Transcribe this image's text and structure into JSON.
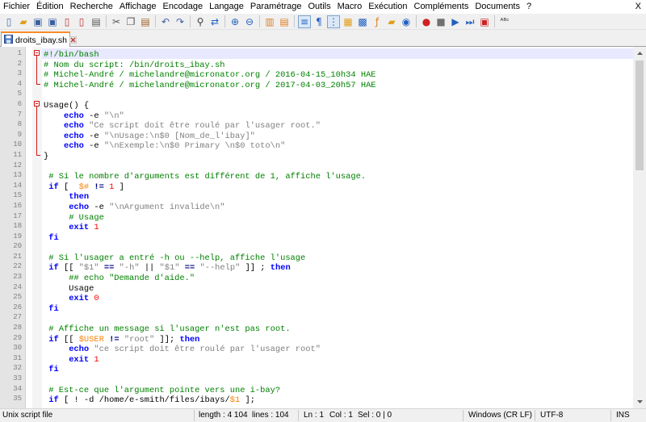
{
  "window": {
    "close_glyph": "X"
  },
  "menu": [
    "Fichier",
    "Édition",
    "Recherche",
    "Affichage",
    "Encodage",
    "Langage",
    "Paramétrage",
    "Outils",
    "Macro",
    "Exécution",
    "Compléments",
    "Documents",
    "?"
  ],
  "toolbar": {
    "groups": [
      [
        {
          "name": "new-file-icon",
          "glyph": "▯",
          "color": "#4a6fb5"
        },
        {
          "name": "open-file-icon",
          "glyph": "▰",
          "color": "#e0a020"
        },
        {
          "name": "save-icon",
          "glyph": "▣",
          "color": "#3a5fa0"
        },
        {
          "name": "save-all-icon",
          "glyph": "▣",
          "color": "#3a5fa0"
        },
        {
          "name": "close-file-icon",
          "glyph": "▯",
          "color": "#c03030"
        },
        {
          "name": "close-all-icon",
          "glyph": "▯",
          "color": "#c03030"
        },
        {
          "name": "print-icon",
          "glyph": "▤",
          "color": "#555555"
        }
      ],
      [
        {
          "name": "cut-icon",
          "glyph": "✂",
          "color": "#555555"
        },
        {
          "name": "copy-icon",
          "glyph": "❐",
          "color": "#555555"
        },
        {
          "name": "paste-icon",
          "glyph": "▤",
          "color": "#a06020"
        }
      ],
      [
        {
          "name": "undo-icon",
          "glyph": "↶",
          "color": "#4060a0"
        },
        {
          "name": "redo-icon",
          "glyph": "↷",
          "color": "#4060a0"
        }
      ],
      [
        {
          "name": "find-icon",
          "glyph": "⚲",
          "color": "#404040"
        },
        {
          "name": "replace-icon",
          "glyph": "⇄",
          "color": "#2060c0"
        }
      ],
      [
        {
          "name": "zoom-in-icon",
          "glyph": "⊕",
          "color": "#2060c0"
        },
        {
          "name": "zoom-out-icon",
          "glyph": "⊖",
          "color": "#2060c0"
        }
      ],
      [
        {
          "name": "sync-vertical-icon",
          "glyph": "▥",
          "color": "#e08020"
        },
        {
          "name": "sync-horizontal-icon",
          "glyph": "▤",
          "color": "#e08020"
        }
      ],
      [
        {
          "name": "word-wrap-icon",
          "glyph": "≡",
          "color": "#2060c0",
          "active": true
        },
        {
          "name": "show-all-chars-icon",
          "glyph": "¶",
          "color": "#2060c0"
        },
        {
          "name": "indent-guide-icon",
          "glyph": "⋮",
          "color": "#2060c0",
          "active": true
        },
        {
          "name": "user-language-icon",
          "glyph": "▦",
          "color": "#e0a020"
        },
        {
          "name": "document-map-icon",
          "glyph": "▩",
          "color": "#2060c0"
        },
        {
          "name": "function-list-icon",
          "glyph": "ƒ",
          "color": "#e08020"
        },
        {
          "name": "folder-workspace-icon",
          "glyph": "▰",
          "color": "#e0a020"
        },
        {
          "name": "monitoring-icon",
          "glyph": "◉",
          "color": "#2060c0"
        }
      ],
      [
        {
          "name": "record-macro-icon",
          "glyph": "●",
          "color": "#d02020"
        },
        {
          "name": "stop-record-icon",
          "glyph": "■",
          "color": "#707070"
        },
        {
          "name": "play-macro-icon",
          "glyph": "▶",
          "color": "#2060c0"
        },
        {
          "name": "play-multiple-icon",
          "glyph": "⏭",
          "color": "#2060c0"
        },
        {
          "name": "save-macro-icon",
          "glyph": "▣",
          "color": "#d02020"
        }
      ],
      [
        {
          "name": "spell-check-icon",
          "glyph": "ᴬᴮᶜ",
          "color": "#303030"
        }
      ]
    ]
  },
  "tab": {
    "label": "droits_ibay.sh"
  },
  "editor": {
    "current_line": 1,
    "lines": [
      [
        [
          "cm",
          "#!/bin/bash"
        ]
      ],
      [
        [
          "cm",
          "# Nom du script: /bin/droits_ibay.sh"
        ]
      ],
      [
        [
          "cm",
          "# Michel-André / michelandre@micronator.org / 2016-04-15_10h34 HAE"
        ]
      ],
      [
        [
          "cm",
          "# Michel-André / michelandre@micronator.org / 2017-04-03_20h57 HAE"
        ]
      ],
      [],
      [
        [
          "",
          "Usage() {"
        ]
      ],
      [
        [
          "",
          "    "
        ],
        [
          "kw",
          "echo"
        ],
        [
          "",
          " -e "
        ],
        [
          "str",
          "\"\\n\""
        ]
      ],
      [
        [
          "",
          "    "
        ],
        [
          "kw",
          "echo"
        ],
        [
          "",
          " "
        ],
        [
          "str",
          "\"Ce script doit être roulé par l'usager root.\""
        ]
      ],
      [
        [
          "",
          "    "
        ],
        [
          "kw",
          "echo"
        ],
        [
          "",
          " -e "
        ],
        [
          "str",
          "\"\\nUsage:\\n$0 [Nom_de_l'ibay]\""
        ]
      ],
      [
        [
          "",
          "    "
        ],
        [
          "kw",
          "echo"
        ],
        [
          "",
          " -e "
        ],
        [
          "str",
          "\"\\nExemple:\\n$0 Primary \\n$0 toto\\n\""
        ]
      ],
      [
        [
          "",
          "}"
        ]
      ],
      [],
      [
        [
          "",
          " "
        ],
        [
          "cm",
          "# Si le nombre d'arguments est différent de 1, affiche l'usage."
        ]
      ],
      [
        [
          "",
          " "
        ],
        [
          "kw",
          "if"
        ],
        [
          "",
          " [  "
        ],
        [
          "var",
          "$#"
        ],
        [
          "",
          " "
        ],
        [
          "op",
          "!="
        ],
        [
          "",
          " "
        ],
        [
          "num",
          "1"
        ],
        [
          "",
          " ]"
        ]
      ],
      [
        [
          "",
          "     "
        ],
        [
          "kw",
          "then"
        ]
      ],
      [
        [
          "",
          "     "
        ],
        [
          "kw",
          "echo"
        ],
        [
          "",
          " -e "
        ],
        [
          "str",
          "\"\\nArgument invalide\\n\""
        ]
      ],
      [
        [
          "",
          "     "
        ],
        [
          "cm",
          "# Usage"
        ]
      ],
      [
        [
          "",
          "     "
        ],
        [
          "kw",
          "exit"
        ],
        [
          "",
          " "
        ],
        [
          "num",
          "1"
        ]
      ],
      [
        [
          "",
          " "
        ],
        [
          "kw",
          "fi"
        ]
      ],
      [],
      [
        [
          "",
          " "
        ],
        [
          "cm",
          "# Si l'usager a entré -h ou --help, affiche l'usage"
        ]
      ],
      [
        [
          "",
          " "
        ],
        [
          "kw",
          "if"
        ],
        [
          "",
          " [[ "
        ],
        [
          "str",
          "\"$1\""
        ],
        [
          "",
          " "
        ],
        [
          "op",
          "=="
        ],
        [
          "",
          " "
        ],
        [
          "str",
          "\"-h\""
        ],
        [
          "",
          " || "
        ],
        [
          "str",
          "\"$1\""
        ],
        [
          "",
          " "
        ],
        [
          "op",
          "=="
        ],
        [
          "",
          " "
        ],
        [
          "str",
          "\"--help\""
        ],
        [
          "",
          " ]] ; "
        ],
        [
          "kw",
          "then"
        ]
      ],
      [
        [
          "",
          "     "
        ],
        [
          "cm",
          "## echo \"Demande d'aide.\""
        ]
      ],
      [
        [
          "",
          "     Usage"
        ]
      ],
      [
        [
          "",
          "     "
        ],
        [
          "kw",
          "exit"
        ],
        [
          "",
          " "
        ],
        [
          "num",
          "0"
        ]
      ],
      [
        [
          "",
          " "
        ],
        [
          "kw",
          "fi"
        ]
      ],
      [],
      [
        [
          "",
          " "
        ],
        [
          "cm",
          "# Affiche un message si l'usager n'est pas root."
        ]
      ],
      [
        [
          "",
          " "
        ],
        [
          "kw",
          "if"
        ],
        [
          "",
          " [[ "
        ],
        [
          "var",
          "$USER"
        ],
        [
          "",
          " "
        ],
        [
          "op",
          "!="
        ],
        [
          "",
          " "
        ],
        [
          "str",
          "\"root\""
        ],
        [
          "",
          " ]]; "
        ],
        [
          "kw",
          "then"
        ]
      ],
      [
        [
          "",
          "     "
        ],
        [
          "kw",
          "echo"
        ],
        [
          "",
          " "
        ],
        [
          "str",
          "\"ce script doit être roulé par l'usager root\""
        ]
      ],
      [
        [
          "",
          "     "
        ],
        [
          "kw",
          "exit"
        ],
        [
          "",
          " "
        ],
        [
          "num",
          "1"
        ]
      ],
      [
        [
          "",
          " "
        ],
        [
          "kw",
          "fi"
        ]
      ],
      [],
      [
        [
          "",
          " "
        ],
        [
          "cm",
          "# Est-ce que l'argument pointe vers une i-bay?"
        ]
      ],
      [
        [
          "",
          " "
        ],
        [
          "kw",
          "if"
        ],
        [
          "",
          " [ ! -d /home/e-smith/files/ibays/"
        ],
        [
          "var",
          "$1"
        ],
        [
          "",
          " ];"
        ]
      ]
    ]
  },
  "status": {
    "language": "Unix script file",
    "length": "length : 4 104",
    "lines": "lines : 104",
    "ln": "Ln : 1",
    "col": "Col : 1",
    "sel": "Sel : 0 | 0",
    "eol": "Windows (CR LF)",
    "encoding": "UTF-8",
    "mode": "INS"
  },
  "colors": {
    "comment": "#008000",
    "keyword": "#0000ff",
    "string": "#808080",
    "number": "#ff0000",
    "variable": "#ff8000",
    "operator": "#000080",
    "fold_marker": "#d01818",
    "active_tab": "#fa8c28"
  }
}
